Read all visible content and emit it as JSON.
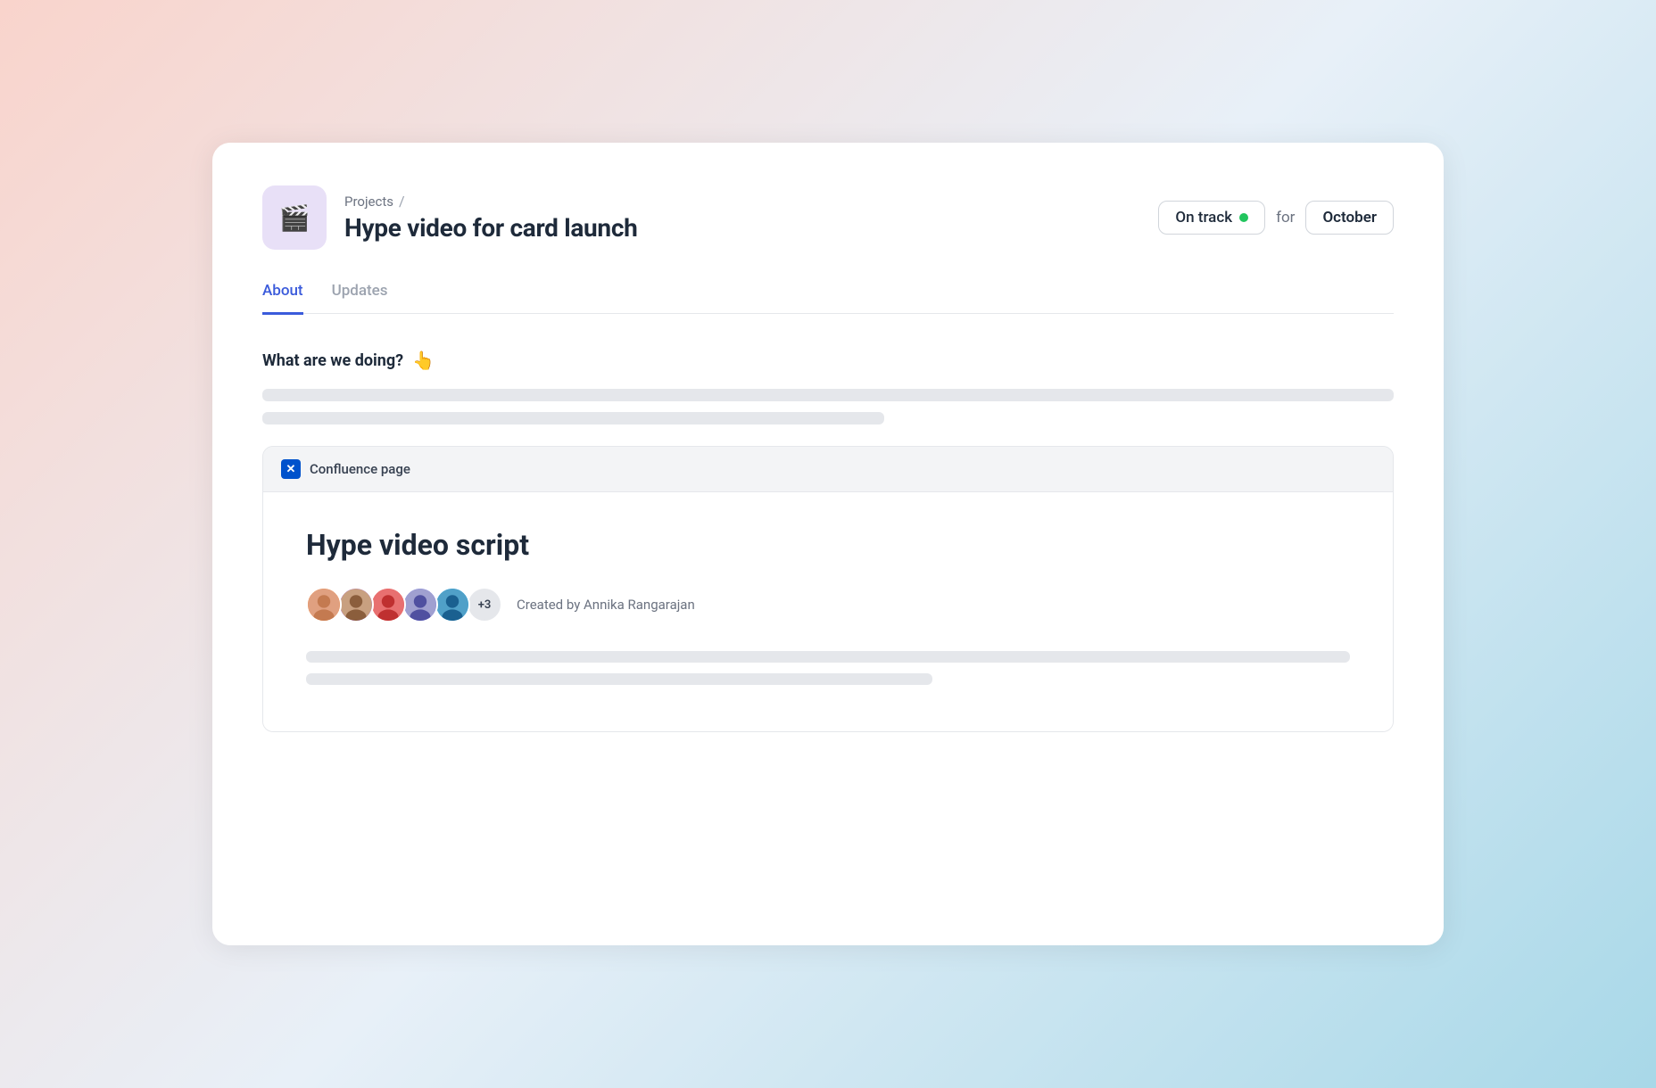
{
  "header": {
    "project_icon": "🎬",
    "breadcrumb_label": "Projects",
    "breadcrumb_separator": "/",
    "project_title": "Hype video for card launch",
    "status_label": "On track",
    "for_label": "for",
    "month_label": "October"
  },
  "tabs": [
    {
      "id": "about",
      "label": "About",
      "active": true
    },
    {
      "id": "updates",
      "label": "Updates",
      "active": false
    }
  ],
  "content": {
    "section_title": "What are we doing?",
    "confluence_header_label": "Confluence page",
    "confluence_icon_label": "✕",
    "confluence_page_title": "Hype video script",
    "avatars_count_label": "+3",
    "created_by_label": "Created by Annika Rangarajan"
  }
}
